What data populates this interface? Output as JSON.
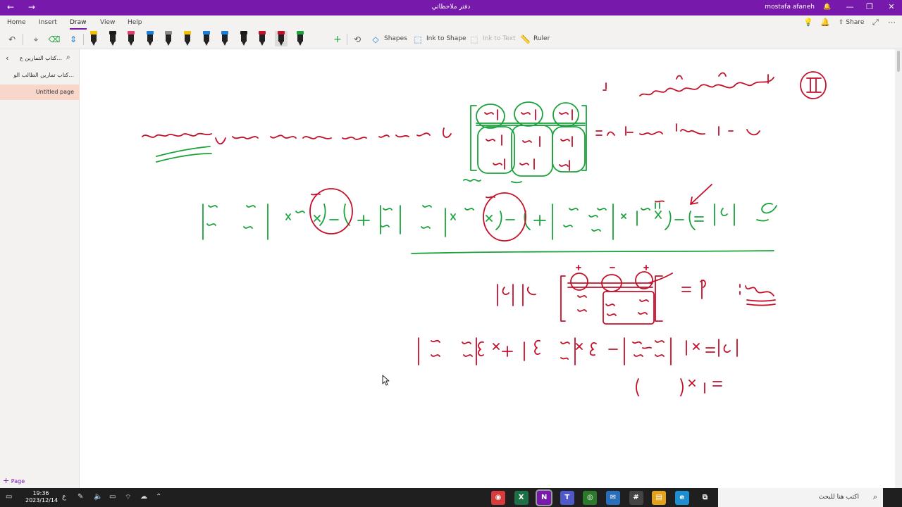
{
  "titlebar": {
    "back": "←",
    "forward": "→",
    "title": "دفتر ملاحظاتي",
    "user": "mostafa afaneh",
    "bell": "🔔",
    "minimize": "—",
    "restore": "❐",
    "close": "✕"
  },
  "tabs": [
    {
      "label": "Home"
    },
    {
      "label": "Insert"
    },
    {
      "label": "Draw",
      "active": true
    },
    {
      "label": "View"
    },
    {
      "label": "Help"
    }
  ],
  "tab_right": {
    "lightbulb": "💡",
    "bell": "🔔",
    "share": "Share",
    "expand": "⤢",
    "more": "⋯"
  },
  "toolbar": {
    "undo": "↶",
    "lasso": "⌖",
    "eraser": "⌫",
    "add_space": "⇕",
    "add_pen": "+",
    "shapes": "Shapes",
    "ink_to_shape": "Ink to Shape",
    "ink_to_text": "Ink to Text",
    "ruler": "Ruler",
    "pens": [
      {
        "name": "pen-black-1",
        "color": "#222222",
        "cap": "#f2c200"
      },
      {
        "name": "pen-black-2",
        "color": "#222222",
        "cap": "#1a1a1a"
      },
      {
        "name": "pen-black-3",
        "color": "#222222",
        "cap": "#e63b6b"
      },
      {
        "name": "pen-black-4",
        "color": "#222222",
        "cap": "#1a7fd6"
      },
      {
        "name": "pen-black-5",
        "color": "#222222",
        "cap": "#8a8a8a"
      },
      {
        "name": "pen-black-6",
        "color": "#222222",
        "cap": "#f2c200"
      },
      {
        "name": "pen-black-7",
        "color": "#222222",
        "cap": "#1a7fd6"
      },
      {
        "name": "pen-black-8",
        "color": "#222222",
        "cap": "#1a7fd6"
      },
      {
        "name": "pen-black-9",
        "color": "#222222",
        "cap": "#1a1a1a"
      },
      {
        "name": "pen-black-10",
        "color": "#222222",
        "cap": "#c4102b"
      },
      {
        "name": "pen-red-selected",
        "color": "#222222",
        "cap": "#c4102b"
      },
      {
        "name": "pen-green",
        "color": "#222222",
        "cap": "#1aa33a"
      }
    ]
  },
  "sidebar": {
    "notebook": "كتاب التمارين ع...",
    "section": "كتاب تمارين الطالب الو...",
    "page": "Untitled page",
    "add_page": "Page"
  },
  "taskbar": {
    "time": "19:36",
    "date": "2023/12/14",
    "lang": "ع",
    "search_placeholder": "اكتب هنا للبحث",
    "apps": [
      {
        "name": "app-icon-1",
        "label": "◉",
        "color": "#d83b3b"
      },
      {
        "name": "excel-icon",
        "label": "X",
        "color": "#1e7145"
      },
      {
        "name": "onenote-icon",
        "label": "N",
        "color": "#7719aa"
      },
      {
        "name": "teams-icon",
        "label": "T",
        "color": "#5059c9"
      },
      {
        "name": "chrome-icon",
        "label": "◎",
        "color": "#2b7a2b"
      },
      {
        "name": "mail-icon",
        "label": "✉",
        "color": "#2a6ebb"
      },
      {
        "name": "calculator-icon",
        "label": "#",
        "color": "#444444"
      },
      {
        "name": "file-explorer-icon",
        "label": "▤",
        "color": "#e3a21a"
      },
      {
        "name": "edge-icon",
        "label": "e",
        "color": "#1d8ecf"
      },
      {
        "name": "task-view-icon",
        "label": "⧉",
        "color": "#1f1f1f"
      }
    ]
  },
  "ink": {
    "red": "#c4102b",
    "green": "#1aa33a"
  }
}
